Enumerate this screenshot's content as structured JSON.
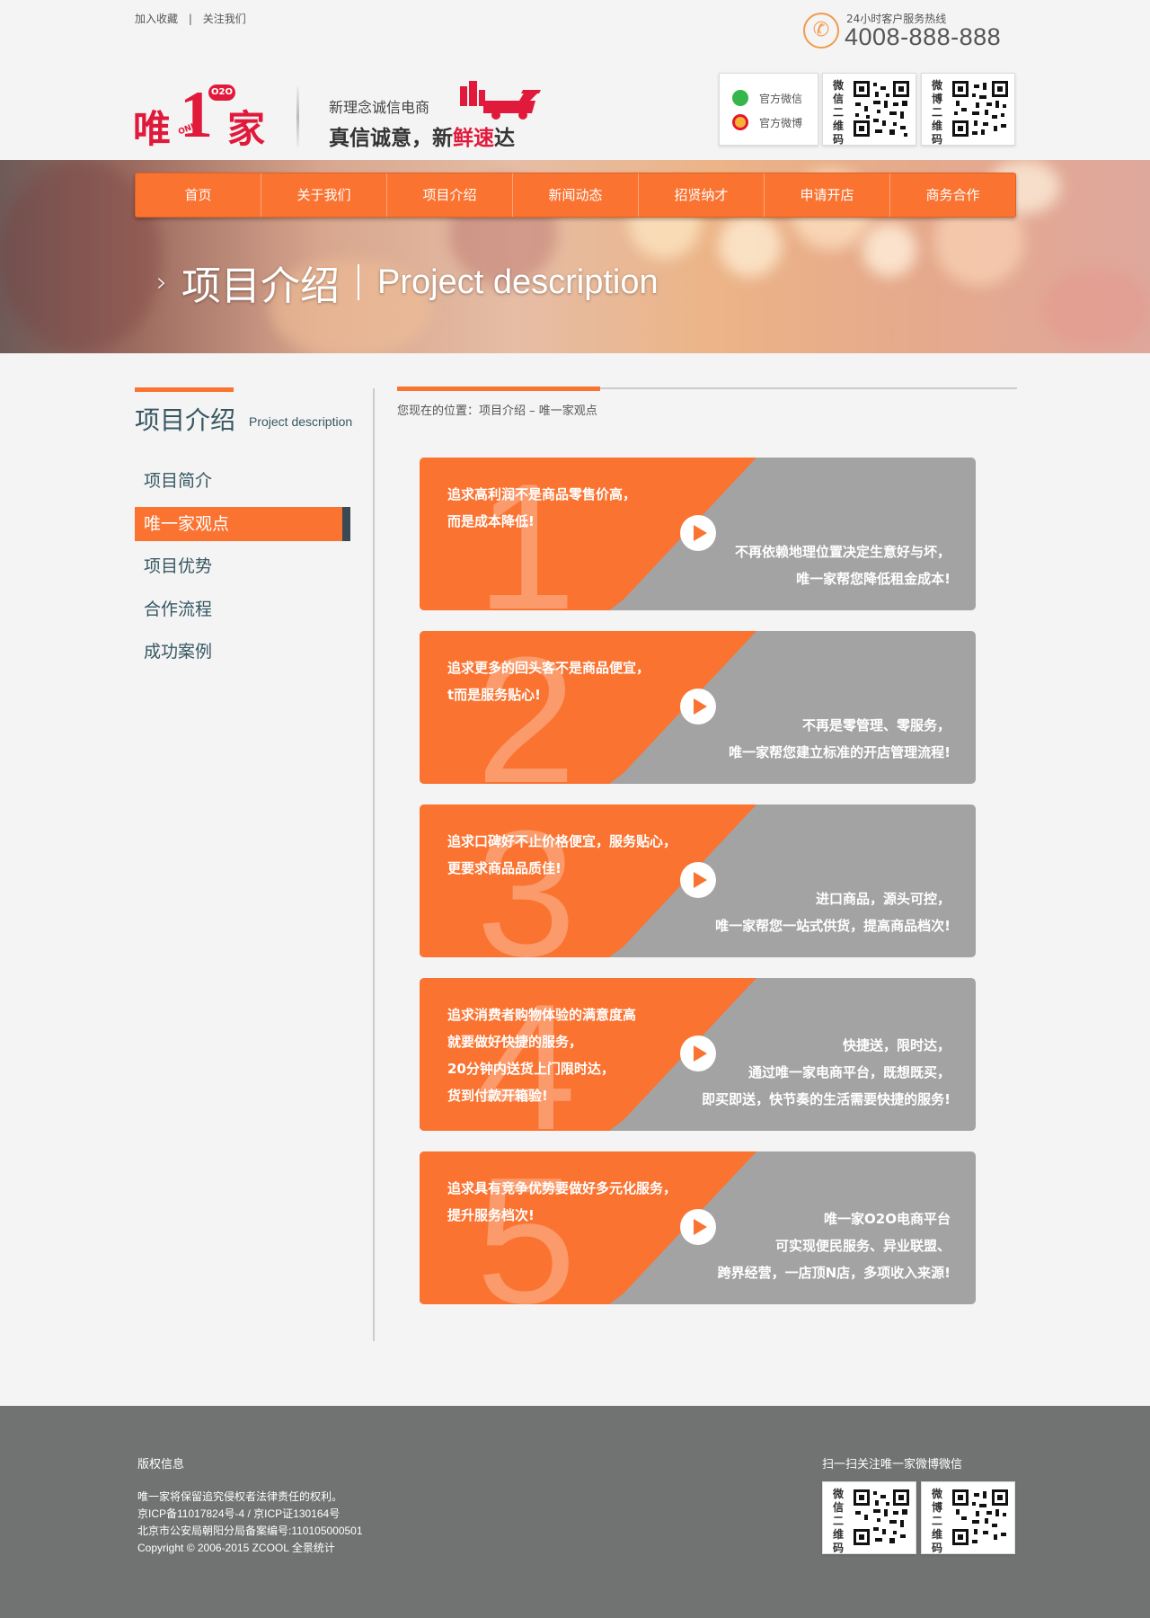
{
  "topbar": {
    "favorite": "加入收藏",
    "separator": "|",
    "follow": "关注我们"
  },
  "hotline": {
    "label": "24小时客户服务热线",
    "number": "4008-888-888"
  },
  "logo": {
    "wei": "唯",
    "one": "1",
    "o2o": "O2O",
    "only": "ONLY",
    "jia": "家"
  },
  "slogan": {
    "line1": "新理念诚信电商",
    "line2_a": "真信诚意，新",
    "line2_b": "鲜速",
    "line2_c": "达"
  },
  "follow": {
    "wechat": "官方微信",
    "weibo": "官方微博"
  },
  "qr": {
    "wechat_label": "微信二维码",
    "weibo_label": "微博二维码"
  },
  "nav": [
    "首页",
    "关于我们",
    "项目介绍",
    "新闻动态",
    "招贤纳才",
    "申请开店",
    "商务合作"
  ],
  "hero": {
    "chevron": "›",
    "title_cn": "项目介绍",
    "title_en": "Project description"
  },
  "sidebar": {
    "title": "项目介绍",
    "subtitle": "Project description",
    "items": [
      "项目简介",
      "唯一家观点",
      "项目优势",
      "合作流程",
      "成功案例"
    ],
    "active_index": 1
  },
  "breadcrumb": "您现在的位置：项目介绍 – 唯一家观点",
  "cards": [
    {
      "num": "1",
      "left": [
        "追求高利润不是商品零售价高，",
        "而是成本降低!"
      ],
      "right": [
        "不再依赖地理位置决定生意好与坏，",
        "唯一家帮您降低租金成本!"
      ]
    },
    {
      "num": "2",
      "left": [
        "追求更多的回头客不是商品便宜，",
        "t而是服务贴心!"
      ],
      "right": [
        "不再是零管理、零服务，",
        "唯一家帮您建立标准的开店管理流程!"
      ]
    },
    {
      "num": "3",
      "left": [
        "追求口碑好不止价格便宜，服务贴心，",
        "更要求商品品质佳!"
      ],
      "right": [
        "进口商品，源头可控，",
        "唯一家帮您一站式供货，提高商品档次!"
      ]
    },
    {
      "num": "4",
      "left": [
        "追求消费者购物体验的满意度高",
        "就要做好快捷的服务，",
        "20分钟内送货上门限时达，",
        "货到付款开箱验!"
      ],
      "right": [
        "快捷送，限时达，",
        "通过唯一家电商平台，既想既买，",
        "即买即送，快节奏的生活需要快捷的服务!"
      ]
    },
    {
      "num": "5",
      "left": [
        "追求具有竞争优势要做好多元化服务，",
        "提升服务档次!"
      ],
      "right": [
        "唯一家O2O电商平台",
        "可实现便民服务、异业联盟、",
        "跨界经营，一店顶N店，多项收入来源!"
      ]
    }
  ],
  "footer": {
    "title": "版权信息",
    "lines": [
      "唯一家将保留追究侵权者法律责任的权利。",
      "京ICP备11017824号-4 / 京ICP证130164号",
      "北京市公安局朝阳分局备案编号:110105000501",
      "Copyright © 2006-2015 ZCOOL 全景统计"
    ],
    "qr_title": "扫一扫关注唯一家微博微信"
  },
  "colors": {
    "accent": "#fa7331",
    "brand_red": "#e11a3b",
    "card_gray": "#a3a3a3",
    "footer_bg": "#717373",
    "text_teal": "#365762"
  }
}
